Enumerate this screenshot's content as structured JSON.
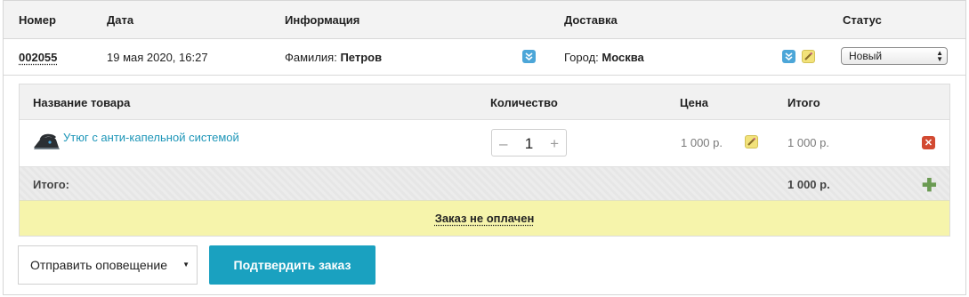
{
  "table_header": {
    "number": "Номер",
    "date": "Дата",
    "info": "Информация",
    "delivery": "Доставка",
    "status": "Статус"
  },
  "order": {
    "number": "002055",
    "date": "19 мая 2020, 16:27",
    "lastname_label": "Фамилия:",
    "lastname_value": "Петров",
    "city_label": "Город:",
    "city_value": "Москва",
    "status_selected": "Новый"
  },
  "items_header": {
    "name": "Название товара",
    "qty": "Количество",
    "price": "Цена",
    "total": "Итого"
  },
  "items": [
    {
      "name": "Утюг с анти-капельной системой",
      "qty": "1",
      "price": "1 000 р.",
      "total": "1 000 р."
    }
  ],
  "stepper": {
    "minus": "–",
    "plus": "+"
  },
  "totals": {
    "label": "Итого:",
    "value": "1 000 р."
  },
  "payment_status": "Заказ не оплачен",
  "actions": {
    "notify_label": "Отправить оповещение",
    "confirm_label": "Подтвердить заказ"
  },
  "icons": {
    "expand": "chevron-double-down-icon",
    "edit": "pencil-icon",
    "delete": "close-icon",
    "add": "plus-icon",
    "product": "iron-icon"
  },
  "colors": {
    "accent": "#1aa1c0",
    "link": "#1e96b8",
    "unpaid_bg": "#f6f4ab",
    "delete": "#d24a32",
    "add": "#6a9a52"
  }
}
